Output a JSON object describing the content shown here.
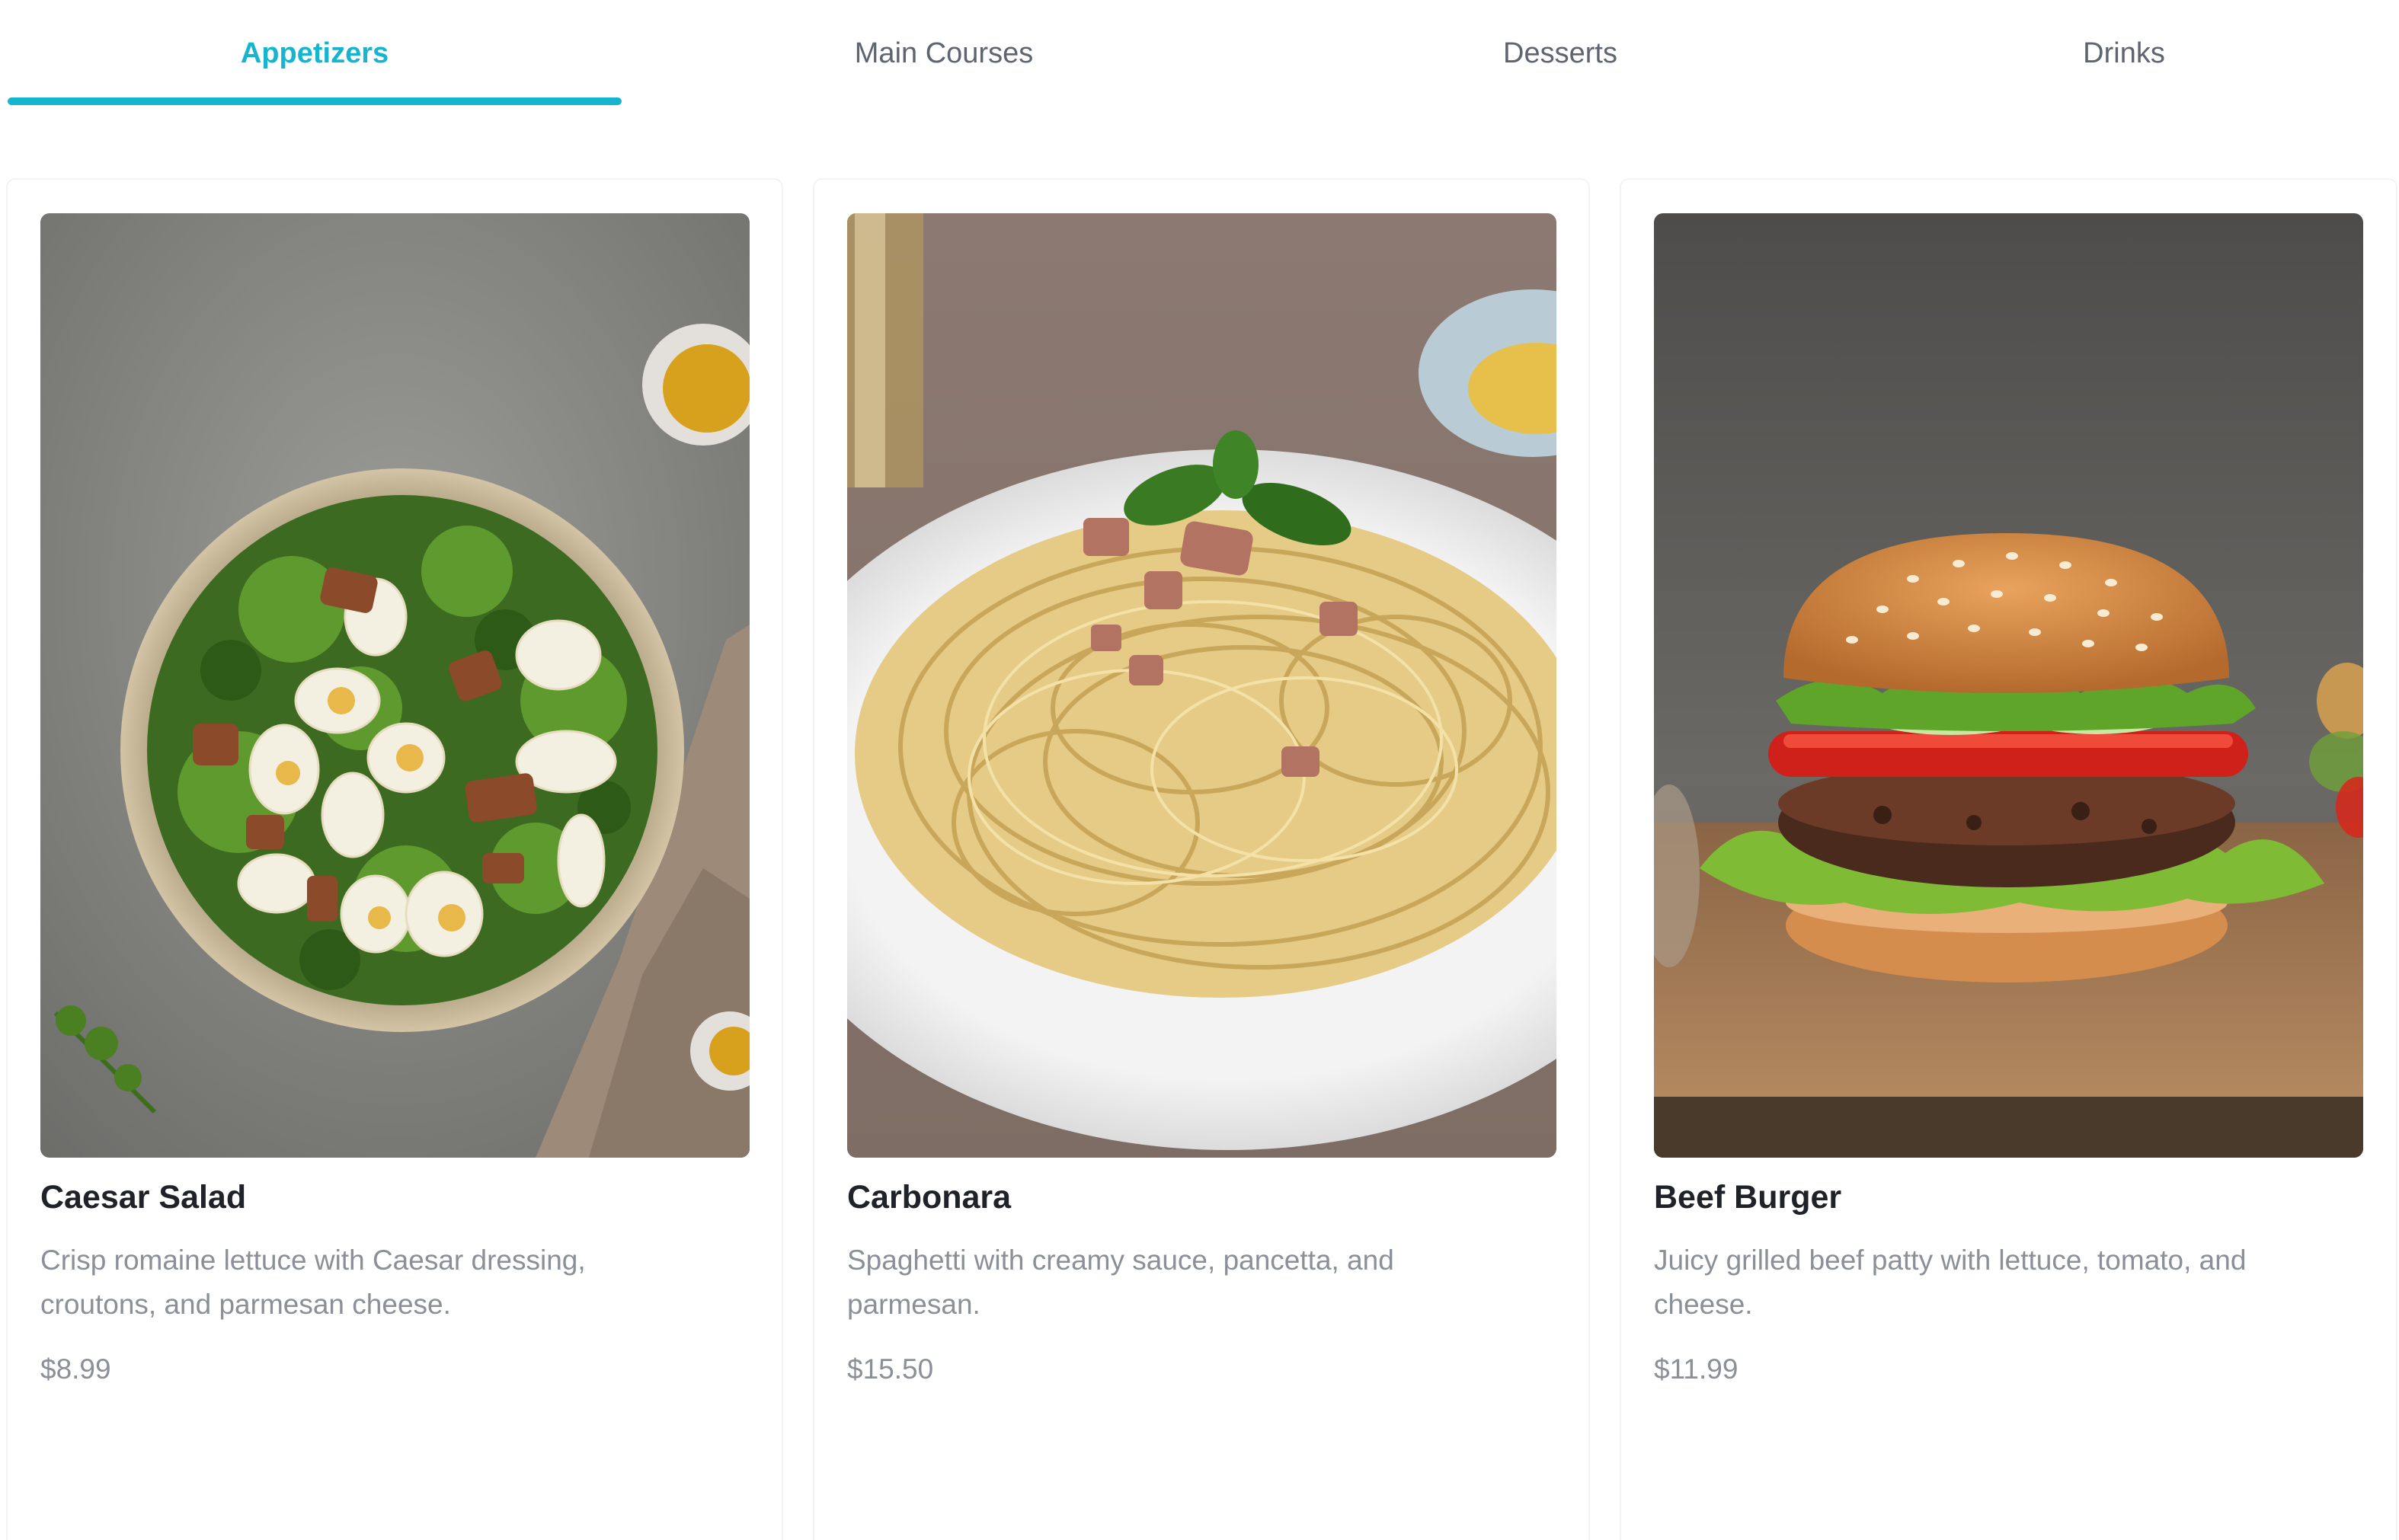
{
  "tabs": [
    {
      "label": "Appetizers",
      "active": true
    },
    {
      "label": "Main Courses",
      "active": false
    },
    {
      "label": "Desserts",
      "active": false
    },
    {
      "label": "Drinks",
      "active": false
    }
  ],
  "accent_color": "#17b4cf",
  "menu_items": [
    {
      "name": "Caesar Salad",
      "description": "Crisp romaine lettuce with Caesar dressing, croutons, and parmesan cheese.",
      "price": "$8.99",
      "image_icon": "caesar-salad-photo"
    },
    {
      "name": "Carbonara",
      "description": "Spaghetti with creamy sauce, pancetta, and parmesan.",
      "price": "$15.50",
      "image_icon": "carbonara-photo"
    },
    {
      "name": "Beef Burger",
      "description": "Juicy grilled beef patty with lettuce, tomato, and cheese.",
      "price": "$11.99",
      "image_icon": "beef-burger-photo"
    }
  ]
}
